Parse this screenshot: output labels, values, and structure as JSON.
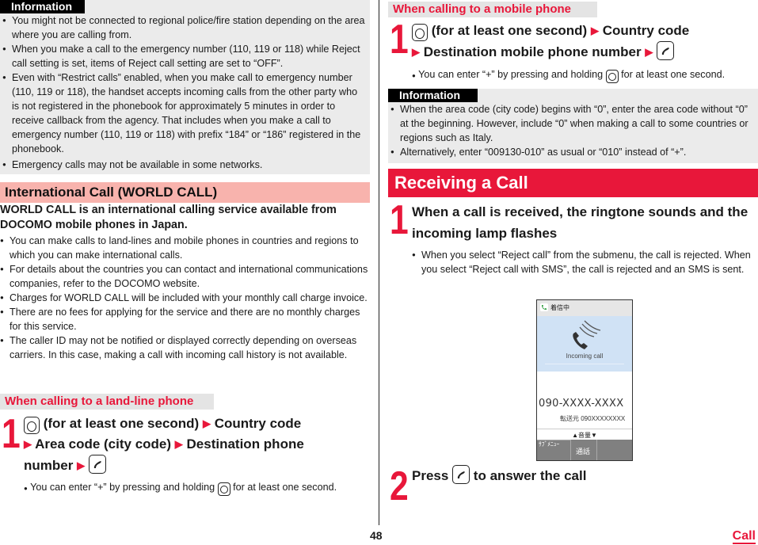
{
  "colors": {
    "accent_red": "#e8173a",
    "info_bg": "#ebebeb",
    "section_pink": "#f8b3ad",
    "subhead_bg": "#e4e4e4"
  },
  "left": {
    "info1": {
      "tag": "Information",
      "bullets": [
        "You might not be connected to regional police/fire station depending on the area where you are calling from.",
        "When you make a call to the emergency number (110, 119 or 118) while Reject call setting is set, items of Reject call setting are set to “OFF”.",
        "Even with “Restrict calls” enabled, when you make call to emergency number (110, 119 or 118), the handset accepts incoming calls from the other party who is not registered in the phonebook for approximately 5 minutes in order to receive callback from the agency. That includes when you make a call to emergency number (110, 119 or 118) with prefix “184” or “186” registered in the phonebook.",
        "Emergency calls may not be available in some networks."
      ]
    },
    "section_title": "International Call (WORLD CALL)",
    "intro": "WORLD CALL is an international calling service available from DOCOMO mobile phones in Japan.",
    "bullets": [
      "You can make calls to land-lines and mobile phones in countries and regions to which you can make international calls.",
      "For details about the countries you can contact and international communications companies, refer to the DOCOMO website.",
      "Charges for WORLD CALL will be included with your monthly call charge invoice.",
      "There are no fees for applying for the service and there are no monthly charges for this service.",
      "The caller ID may not be notified or displayed correctly depending on overseas carriers. In this case, making a call with incoming call history is not available."
    ],
    "landline": {
      "heading": "When calling to a land-line phone",
      "step_number": "1",
      "step_parts": [
        "(for at least one second)",
        "Country code",
        "Area code (city code)",
        "Destination phone",
        "number"
      ],
      "note_before": "You can enter “+” by pressing and holding",
      "note_after": "for at least one second."
    }
  },
  "right": {
    "mobile": {
      "heading": "When calling to a mobile phone",
      "step_number": "1",
      "step_parts": [
        "(for at least one second)",
        "Country code",
        "Destination mobile phone number"
      ],
      "note_before": "You can enter “+” by pressing and holding",
      "note_after": "for at least one second."
    },
    "info2": {
      "tag": "Information",
      "bullets": [
        "When the area code (city code) begins with “0”, enter the area code without “0” at the beginning. However, include “0” when making a call to some countries or regions such as Italy.",
        "Alternatively, enter “009130-010” as usual or “010” instead of “+”."
      ]
    },
    "receiving": {
      "title": "Receiving a Call",
      "step1_number": "1",
      "step1_text": "When a call is received, the ringtone sounds and the incoming lamp flashes",
      "step1_note": "When you select “Reject call” from the submenu, the call is rejected. When you select “Reject call with SMS”, the call is rejected and an SMS is sent.",
      "step2_number": "2",
      "step2_before": "Press",
      "step2_after": "to answer the call"
    },
    "phone_screen": {
      "status": "着信中",
      "incoming_label": "Incoming call",
      "number": "090-XXXX-XXXX",
      "forward": "転送元 090XXXXXXXX",
      "volume": "▲音量▼",
      "softkey_left": "ｻﾌﾞﾒﾆｭｰ",
      "softkey_center": "通話"
    }
  },
  "footer": {
    "page_number": "48",
    "section_link": "Call"
  }
}
